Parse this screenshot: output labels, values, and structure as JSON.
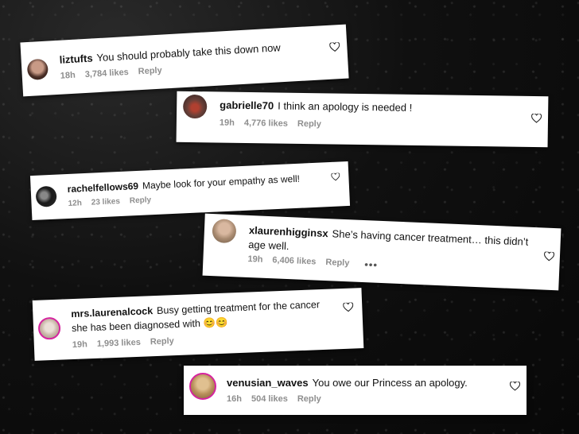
{
  "comments": [
    {
      "username": "liztufts",
      "text": "You should probably take this down now",
      "time": "18h",
      "likes": "3,784 likes",
      "reply": "Reply"
    },
    {
      "username": "gabrielle70",
      "text": "I think an apology is needed !",
      "time": "19h",
      "likes": "4,776 likes",
      "reply": "Reply"
    },
    {
      "username": "rachelfellows69",
      "text": "Maybe look for your empathy as well!",
      "time": "12h",
      "likes": "23 likes",
      "reply": "Reply"
    },
    {
      "username": "xlaurenhigginsx",
      "text": "She’s having cancer treatment… this didn’t age well.",
      "time": "19h",
      "likes": "6,406 likes",
      "reply": "Reply",
      "more": "•••"
    },
    {
      "username": "mrs.laurenalcock",
      "text": "Busy getting treatment for the cancer she has been diagnosed with 😊😊",
      "time": "19h",
      "likes": "1,993 likes",
      "reply": "Reply"
    },
    {
      "username": "venusian_waves",
      "text": "You owe our Princess an apology.",
      "time": "16h",
      "likes": "504 likes",
      "reply": "Reply"
    }
  ],
  "colors": {
    "background": "#0c0c0c",
    "card": "#ffffff",
    "meta_text": "#8e8e8e",
    "story_ring": "#d6249f"
  }
}
